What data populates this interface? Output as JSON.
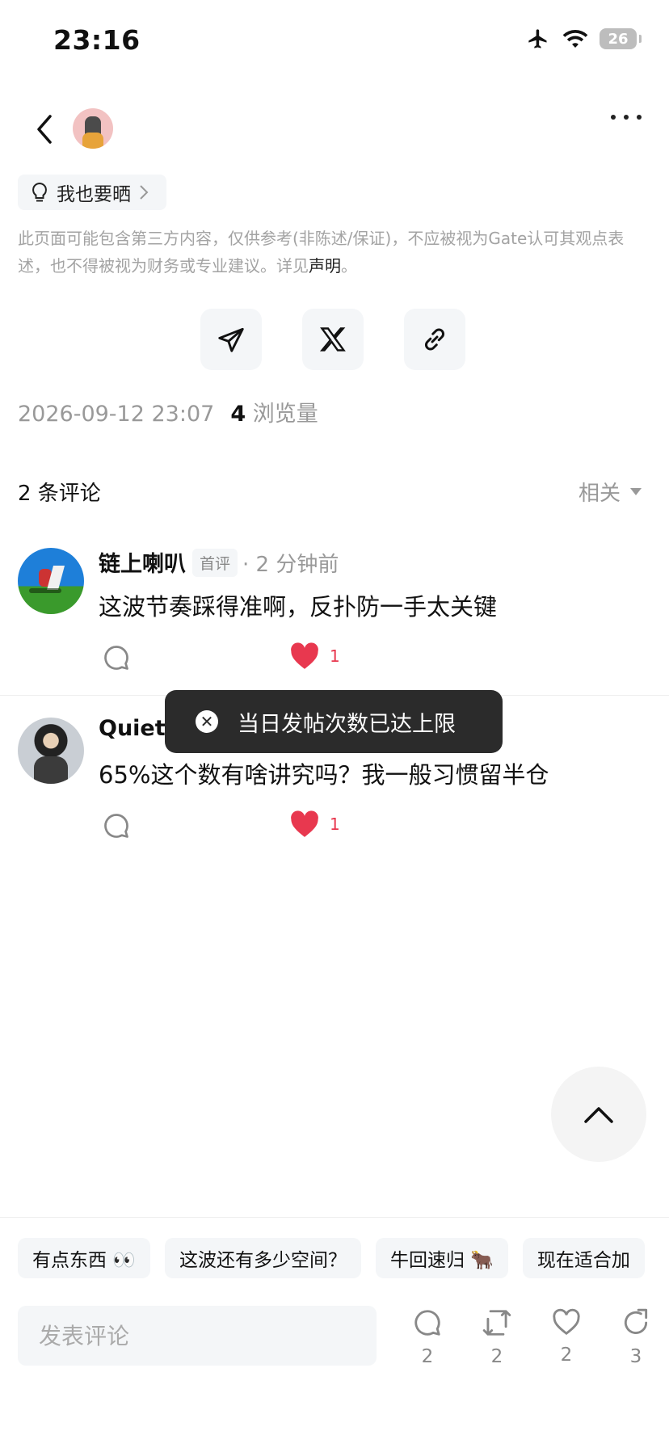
{
  "status_bar": {
    "time": "23:16",
    "battery": "26"
  },
  "share_pill": {
    "label": "我也要晒"
  },
  "disclaimer": {
    "text": "此页面可能包含第三方内容，仅供参考(非陈述/保证)，不应被视为Gate认可其观点表述，也不得被视为财务或专业建议。详见",
    "link": "声明",
    "end": "。"
  },
  "meta": {
    "datetime": "2026-09-12 23:07",
    "views": "4",
    "views_label": "浏览量"
  },
  "comments_header": {
    "title": "2 条评论",
    "sort": "相关"
  },
  "comments": [
    {
      "name": "链上喇叭",
      "badge": "首评",
      "time": "· 2 分钟前",
      "text": "这波节奏踩得准啊，反扑防一手太关键",
      "likes": "1"
    },
    {
      "name": "QuietV",
      "text": "65%这个数有啥讲究吗？我一般习惯留半仓",
      "likes": "1"
    }
  ],
  "toast": {
    "text": "当日发帖次数已达上限"
  },
  "quick_replies": [
    "有点东西 👀",
    "这波还有多少空间？",
    "牛回速归 🐂",
    "现在适合加"
  ],
  "comment_input": {
    "placeholder": "发表评论"
  },
  "bottom_actions": {
    "comments": "2",
    "reposts": "2",
    "likes": "2",
    "shares": "3"
  },
  "colors": {
    "like_red": "#e8384f",
    "toast_bg": "#2b2b2b",
    "chip_bg": "#f4f6f8"
  }
}
